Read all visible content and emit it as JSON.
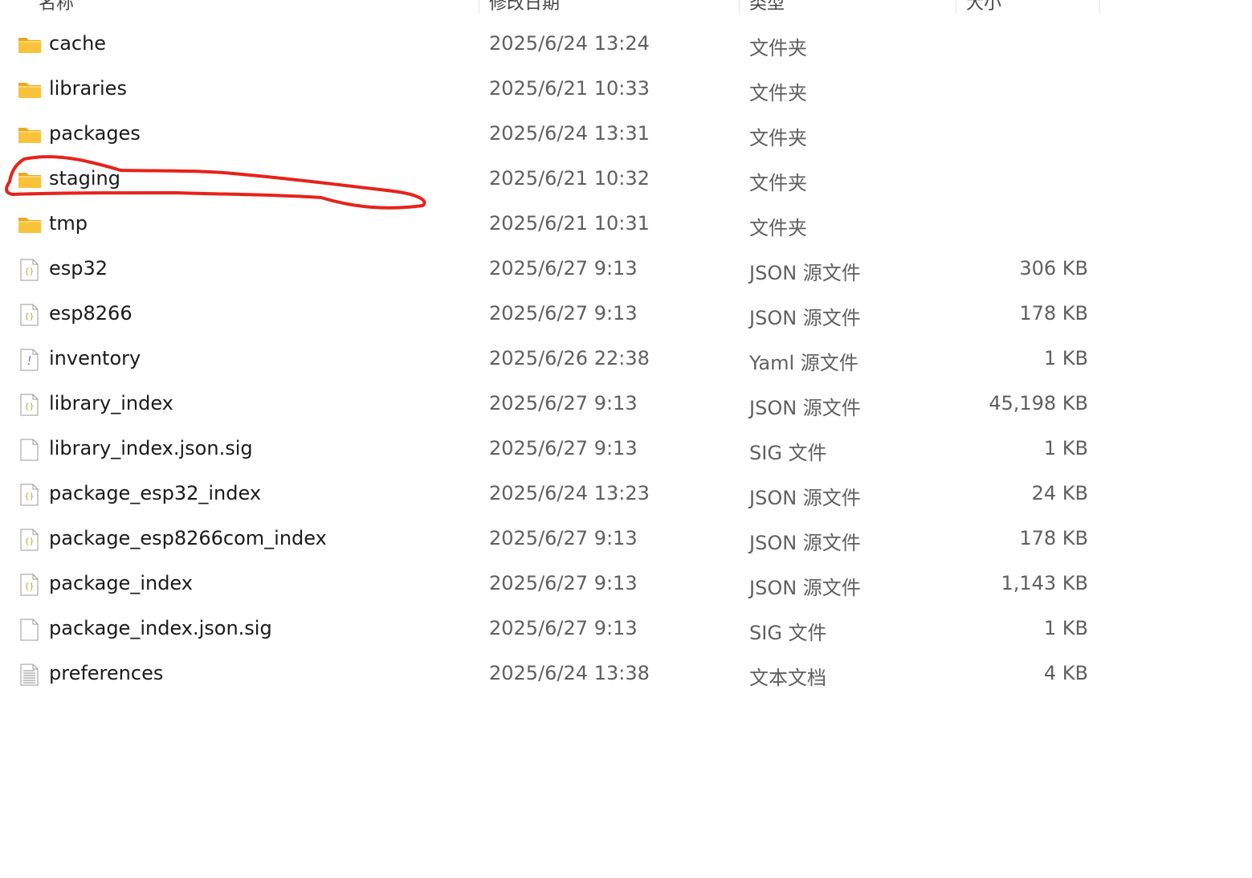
{
  "columns": {
    "name": "名称",
    "modified": "修改日期",
    "type": "类型",
    "size": "大小"
  },
  "files": [
    {
      "name": "cache",
      "modified": "2025/6/24 13:24",
      "type": "文件夹",
      "size": "",
      "icon": "folder-icon"
    },
    {
      "name": "libraries",
      "modified": "2025/6/21 10:33",
      "type": "文件夹",
      "size": "",
      "icon": "folder-icon"
    },
    {
      "name": "packages",
      "modified": "2025/6/24 13:31",
      "type": "文件夹",
      "size": "",
      "icon": "folder-icon"
    },
    {
      "name": "staging",
      "modified": "2025/6/21 10:32",
      "type": "文件夹",
      "size": "",
      "icon": "folder-icon"
    },
    {
      "name": "tmp",
      "modified": "2025/6/21 10:31",
      "type": "文件夹",
      "size": "",
      "icon": "folder-icon"
    },
    {
      "name": "esp32",
      "modified": "2025/6/27 9:13",
      "type": "JSON 源文件",
      "size": "306 KB",
      "icon": "json-file-icon"
    },
    {
      "name": "esp8266",
      "modified": "2025/6/27 9:13",
      "type": "JSON 源文件",
      "size": "178 KB",
      "icon": "json-file-icon"
    },
    {
      "name": "inventory",
      "modified": "2025/6/26 22:38",
      "type": "Yaml 源文件",
      "size": "1 KB",
      "icon": "yaml-file-icon"
    },
    {
      "name": "library_index",
      "modified": "2025/6/27 9:13",
      "type": "JSON 源文件",
      "size": "45,198 KB",
      "icon": "json-file-icon"
    },
    {
      "name": "library_index.json.sig",
      "modified": "2025/6/27 9:13",
      "type": "SIG 文件",
      "size": "1 KB",
      "icon": "blank-file-icon"
    },
    {
      "name": "package_esp32_index",
      "modified": "2025/6/24 13:23",
      "type": "JSON 源文件",
      "size": "24 KB",
      "icon": "json-file-icon"
    },
    {
      "name": "package_esp8266com_index",
      "modified": "2025/6/27 9:13",
      "type": "JSON 源文件",
      "size": "178 KB",
      "icon": "json-file-icon"
    },
    {
      "name": "package_index",
      "modified": "2025/6/27 9:13",
      "type": "JSON 源文件",
      "size": "1,143 KB",
      "icon": "json-file-icon"
    },
    {
      "name": "package_index.json.sig",
      "modified": "2025/6/27 9:13",
      "type": "SIG 文件",
      "size": "1 KB",
      "icon": "blank-file-icon"
    },
    {
      "name": "preferences",
      "modified": "2025/6/24 13:38",
      "type": "文本文档",
      "size": "4 KB",
      "icon": "text-file-icon"
    }
  ],
  "annotation": {
    "color": "#e8221b",
    "target": "staging"
  },
  "colors": {
    "folder": "#f8c33a",
    "secondary_text": "#5f5f5f"
  }
}
